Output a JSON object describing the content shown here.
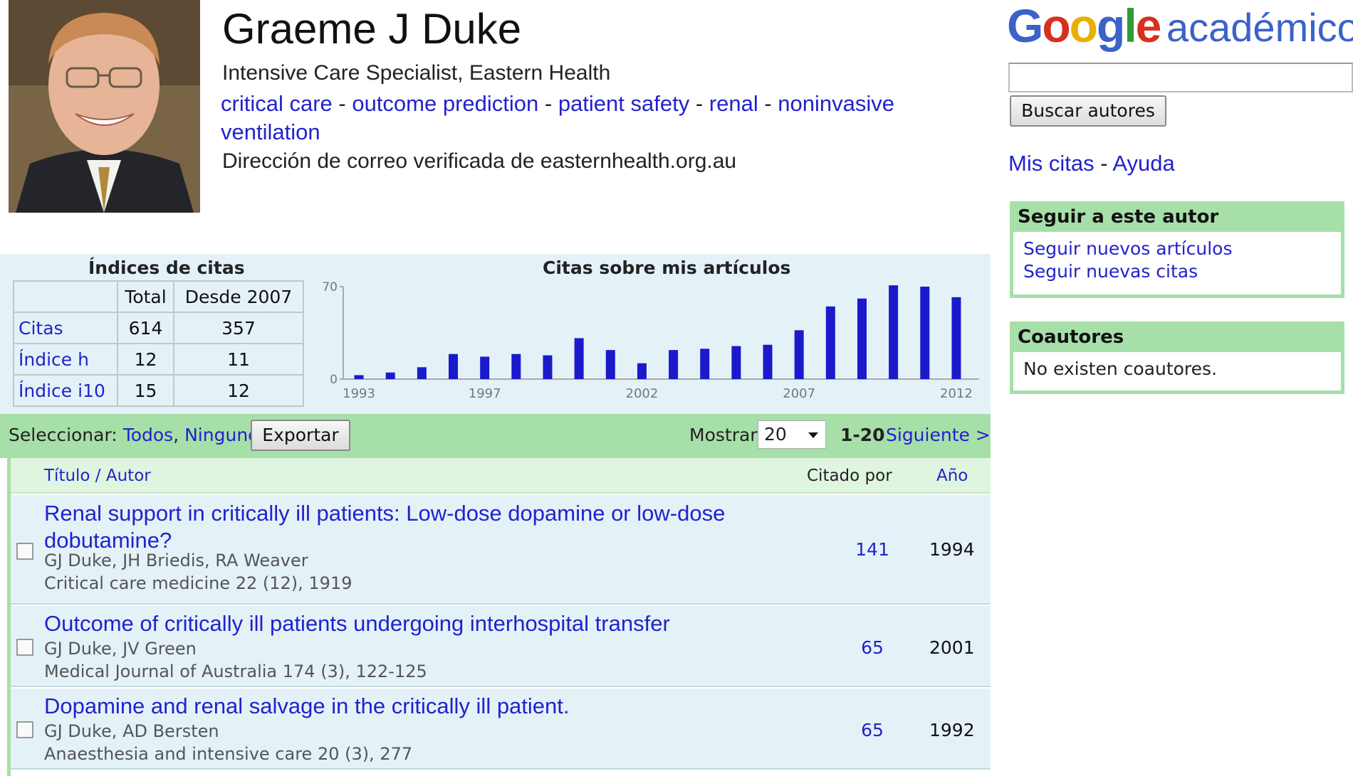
{
  "profile": {
    "name": "Graeme J Duke",
    "affiliation": "Intensive Care Specialist, Eastern Health",
    "interests": [
      "critical care",
      "outcome prediction",
      "patient safety",
      "renal",
      "noninvasive ventilation"
    ],
    "interest_separator": " - ",
    "email": "Dirección de correo verificada de easternhealth.org.au"
  },
  "header": {
    "logo_google": "Google",
    "logo_sub": "académico",
    "search_placeholder": "",
    "search_button": "Buscar autores",
    "my_citations": "Mis citas",
    "separator": " - ",
    "help": "Ayuda"
  },
  "follow": {
    "title": "Seguir a este autor",
    "new_articles": "Seguir nuevos artículos",
    "new_citations": "Seguir nuevas citas"
  },
  "coauthors": {
    "title": "Coautores",
    "empty": "No existen coautores."
  },
  "citation_indices": {
    "title": "Índices de citas",
    "headers": [
      "",
      "Total",
      "Desde 2007"
    ],
    "rows": [
      {
        "label": "Citas",
        "total": "614",
        "since": "357"
      },
      {
        "label": "Índice h",
        "total": "12",
        "since": "11"
      },
      {
        "label": "Índice i10",
        "total": "15",
        "since": "12"
      }
    ]
  },
  "chart_data": {
    "type": "bar",
    "title": "Citas sobre mis artículos",
    "xlabel": "",
    "ylabel": "",
    "ylim": [
      0,
      70
    ],
    "yticks": [
      "0",
      "70"
    ],
    "xtick_labels": [
      "1993",
      "1997",
      "2002",
      "2007",
      "2012"
    ],
    "categories": [
      "1993",
      "1994",
      "1995",
      "1996",
      "1997",
      "1998",
      "1999",
      "2000",
      "2001",
      "2002",
      "2003",
      "2004",
      "2005",
      "2006",
      "2007",
      "2008",
      "2009",
      "2010",
      "2011",
      "2012"
    ],
    "values": [
      3,
      5,
      9,
      19,
      17,
      19,
      18,
      31,
      22,
      12,
      22,
      23,
      25,
      26,
      37,
      55,
      61,
      71,
      70,
      62
    ],
    "bar_color": "#1a1acc"
  },
  "toolbar": {
    "select_label": "Seleccionar:",
    "all": "Todos",
    "comma": ",",
    "none": "Ninguno",
    "export": "Exportar",
    "show_label": "Mostrar:",
    "show_value": "20",
    "range": "1-20",
    "next": "Siguiente >"
  },
  "articles": {
    "headers": {
      "title": "Título / Autor",
      "cited_by": "Citado por",
      "year": "Año"
    },
    "items": [
      {
        "title": "Renal support in critically ill patients: Low-dose dopamine or low-dose dobutamine?",
        "authors": "GJ Duke, JH Briedis, RA Weaver",
        "venue": "Critical care medicine 22 (12), 1919",
        "cited_by": "141",
        "year": "1994"
      },
      {
        "title": "Outcome of critically ill patients undergoing interhospital transfer",
        "authors": "GJ Duke, JV Green",
        "venue": "Medical Journal of Australia 174 (3), 122-125",
        "cited_by": "65",
        "year": "2001"
      },
      {
        "title": "Dopamine and renal salvage in the critically ill patient.",
        "authors": "GJ Duke, AD Bersten",
        "venue": "Anaesthesia and intensive care 20 (3), 277",
        "cited_by": "65",
        "year": "1992"
      }
    ]
  }
}
